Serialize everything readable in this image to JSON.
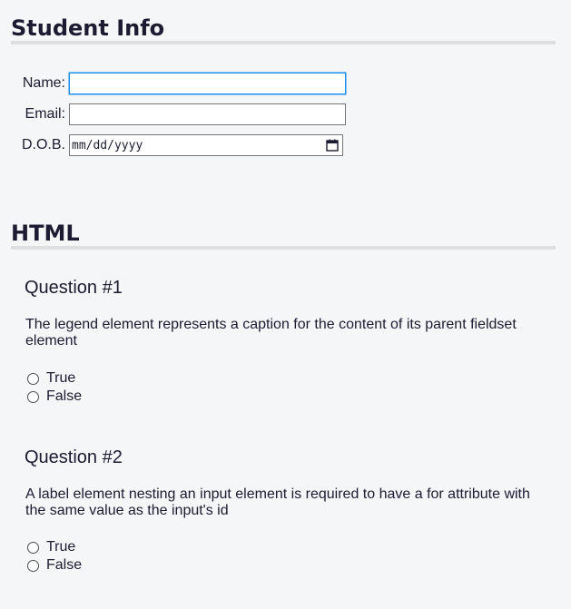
{
  "student_info": {
    "heading": "Student Info",
    "fields": [
      {
        "label": "Name:",
        "value": ""
      },
      {
        "label": "Email:",
        "value": ""
      },
      {
        "label": "D.O.B.",
        "value": "mm/dd/yyyy"
      }
    ]
  },
  "html_section": {
    "heading": "HTML",
    "questions": [
      {
        "title": "Question #1",
        "text": "The legend element represents a caption for the content of its parent fieldset element",
        "options": [
          "True",
          "False"
        ]
      },
      {
        "title": "Question #2",
        "text": "A label element nesting an input element is required to have a for attribute with the same value as the input's id",
        "options": [
          "True",
          "False"
        ]
      }
    ]
  },
  "icons": {
    "date_picker": "calendar-icon",
    "radio": "radio-unchecked-icon"
  },
  "colors": {
    "background": "#f5f6f7",
    "text": "#1b1b32",
    "rule": "#dfdfe2",
    "focus": "#198eee"
  }
}
